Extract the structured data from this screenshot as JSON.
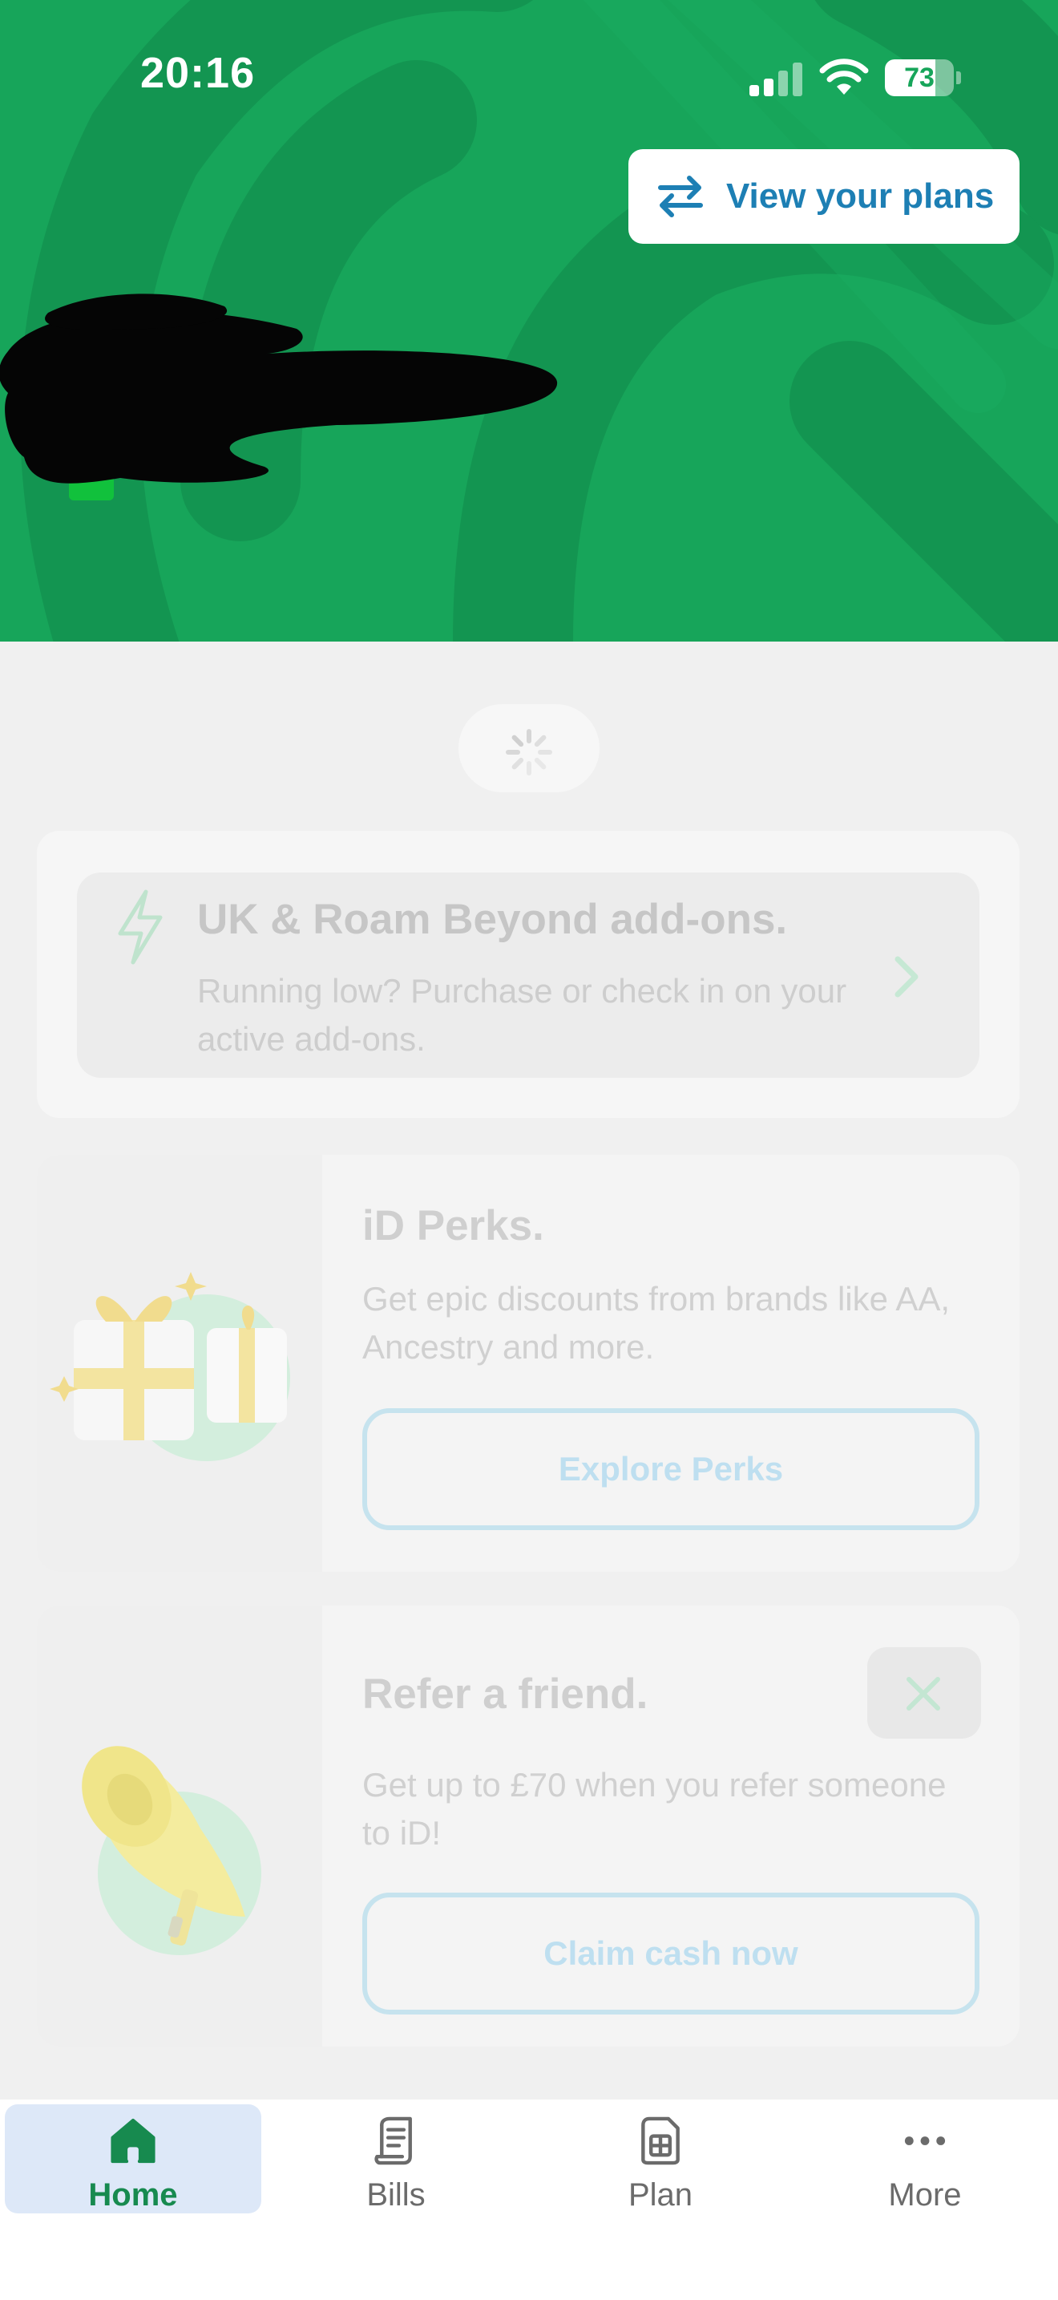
{
  "status_bar": {
    "time": "20:16",
    "battery_level": "73",
    "battery_fraction": 0.73,
    "signal_icon": "cellular-signal-icon",
    "wifi_icon": "wifi-icon"
  },
  "hero": {
    "background_color": "#17a55a",
    "view_plans_label": "View your plans",
    "view_plans_icon": "swap-arrows-icon",
    "account_info_redacted": true
  },
  "loading": {
    "icon": "spinner-icon"
  },
  "addons_card": {
    "icon": "lightning-bolt-icon",
    "title": "UK & Roam Beyond add-ons.",
    "description": "Running low? Purchase or check in on your active add-ons."
  },
  "perks_card": {
    "image": "gift-boxes-illustration",
    "title": "iD Perks.",
    "description": "Get epic discounts from brands like AA, Ancestry and more.",
    "button_label": "Explore Perks"
  },
  "refer_card": {
    "image": "megaphone-illustration",
    "title": "Refer a friend.",
    "description": "Get up to £70 when you refer someone to iD!",
    "button_label": "Claim cash now"
  },
  "tab_bar": {
    "tabs": [
      {
        "label": "Home",
        "icon": "home-icon",
        "selected": true
      },
      {
        "label": "Bills",
        "icon": "bills-icon",
        "selected": false
      },
      {
        "label": "Plan",
        "icon": "sim-card-icon",
        "selected": false
      },
      {
        "label": "More",
        "icon": "more-dots-icon",
        "selected": false
      }
    ]
  },
  "colors": {
    "brand_green": "#17a55a",
    "link_blue": "#1d7fb4",
    "selected_tab_bg": "#dde8f8"
  }
}
